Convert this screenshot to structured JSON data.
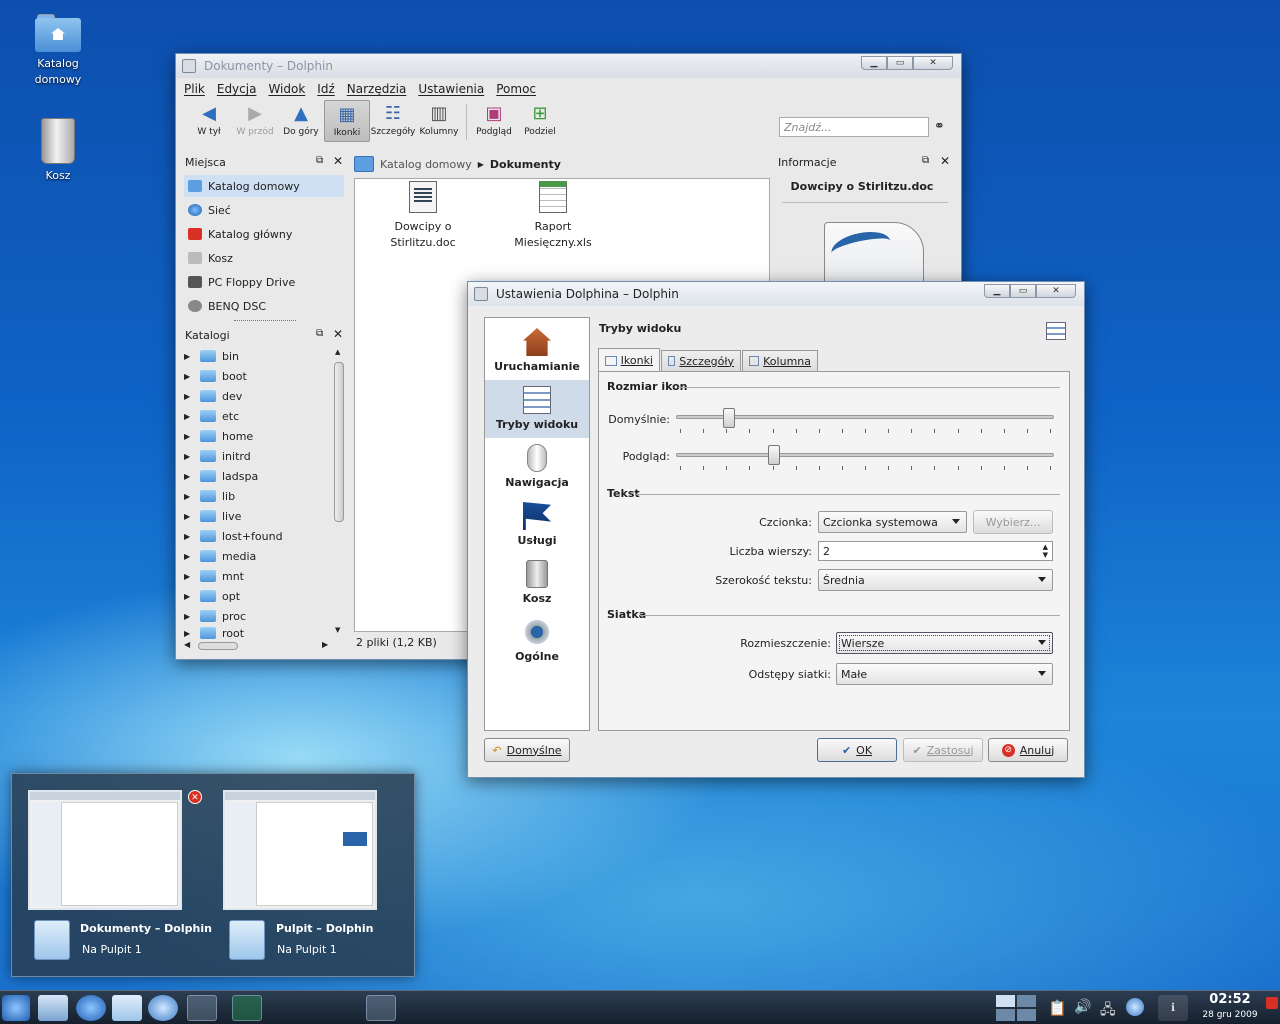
{
  "desktop": {
    "icons": [
      {
        "label": "Katalog domowy",
        "icon": "home-folder-icon"
      },
      {
        "label": "Kosz",
        "icon": "trash-icon"
      }
    ]
  },
  "dolphin": {
    "title": "Dokumenty – Dolphin",
    "menu": [
      "Plik",
      "Edycja",
      "Widok",
      "Idź",
      "Narzędzia",
      "Ustawienia",
      "Pomoc"
    ],
    "toolbar": [
      {
        "label": "W tył",
        "icon": "arrow-left-icon"
      },
      {
        "label": "W przód",
        "icon": "arrow-right-icon"
      },
      {
        "label": "Do góry",
        "icon": "arrow-up-icon"
      },
      {
        "label": "Ikonki",
        "icon": "icons-view-icon"
      },
      {
        "label": "Szczegóły",
        "icon": "details-view-icon"
      },
      {
        "label": "Kolumny",
        "icon": "columns-view-icon"
      },
      {
        "label": "Podgląd",
        "icon": "preview-icon"
      },
      {
        "label": "Podziel",
        "icon": "split-icon"
      }
    ],
    "search_placeholder": "Znajdź...",
    "places_title": "Miejsca",
    "places": [
      "Katalog domowy",
      "Sieć",
      "Katalog główny",
      "Kosz",
      "PC Floppy Drive",
      "BENQ DSC"
    ],
    "folders_title": "Katalogi",
    "folders": [
      "bin",
      "boot",
      "dev",
      "etc",
      "home",
      "initrd",
      "ladspa",
      "lib",
      "live",
      "lost+found",
      "media",
      "mnt",
      "opt",
      "proc",
      "root"
    ],
    "breadcrumb": {
      "home": "Katalog domowy",
      "current": "Dokumenty"
    },
    "files": [
      {
        "name": "Dowcipy o Stirlitzu.doc",
        "line1": "Dowcipy o",
        "line2": "Stirlitzu.doc"
      },
      {
        "name": "Raport Miesięczny.xls",
        "line1": "Raport",
        "line2": "Miesięczny.xls"
      }
    ],
    "status": "2 pliki (1,2 KB)",
    "info_title": "Informacje",
    "info_file": "Dowcipy o Stirlitzu.doc"
  },
  "settings": {
    "title": "Ustawienia Dolphina – Dolphin",
    "sidebar": [
      "Uruchamianie",
      "Tryby widoku",
      "Nawigacja",
      "Usługi",
      "Kosz",
      "Ogólne"
    ],
    "section_title": "Tryby widoku",
    "tabs": [
      "Ikonki",
      "Szczegóły",
      "Kolumna"
    ],
    "group_icons": "Rozmiar ikon",
    "label_default": "Domyślnie:",
    "label_preview": "Podgląd:",
    "slider_default_value": 0.14,
    "slider_preview_value": 0.26,
    "group_text": "Tekst",
    "label_font": "Czcionka:",
    "font_value": "Czcionka systemowa",
    "choose_button": "Wybierz...",
    "label_lines": "Liczba wierszy:",
    "lines_value": "2",
    "label_width": "Szerokość tekstu:",
    "width_value": "Średnia",
    "group_grid": "Siatka",
    "label_arrangement": "Rozmieszczenie:",
    "arrangement_value": "Wiersze",
    "label_spacing": "Odstępy siatki:",
    "spacing_value": "Małe",
    "defaults_button": "Domyślne",
    "ok_button": "OK",
    "apply_button": "Zastosuj",
    "cancel_button": "Anuluj"
  },
  "switcher": {
    "windows": [
      {
        "title": "Dokumenty – Dolphin",
        "desktop": "Na Pulpit 1"
      },
      {
        "title": "Pulpit – Dolphin",
        "desktop": "Na Pulpit 1"
      }
    ]
  },
  "taskbar": {
    "time": "02:52",
    "date": "28 gru 2009"
  },
  "colors": {
    "desktop_top": "#0d4fae",
    "selection": "#cfe0f5",
    "close_red": "#d93025"
  }
}
